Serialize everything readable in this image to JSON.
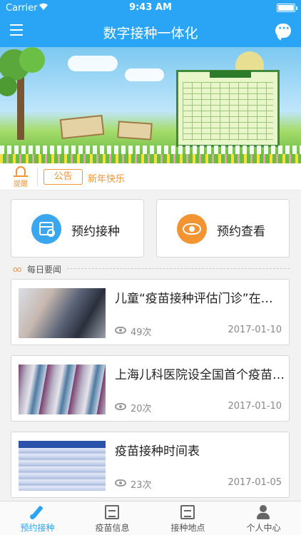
{
  "status_bar": {
    "carrier": "Carrier",
    "time": "9:43 AM"
  },
  "nav_bar": {
    "title": "数字接种一体化",
    "menu_icon": "menu-icon",
    "message_icon": "chat-bubble-icon"
  },
  "notice": {
    "bell_label": "提醒",
    "tag": "公告",
    "text": "新年快乐"
  },
  "actions": [
    {
      "label": "预约接种",
      "icon": "calendar-clock-icon",
      "color": "#3aa6ee"
    },
    {
      "label": "预约查看",
      "icon": "eye-icon",
      "color": "#f39433"
    }
  ],
  "news_section": {
    "title": "每日要闻"
  },
  "news": [
    {
      "title": "儿童“疫苗接种评估门诊”在北京多家医院开诊",
      "views": "49次",
      "date": "2017-01-10"
    },
    {
      "title": "上海儿科医院设全国首个疫苗评估门诊",
      "views": "20次",
      "date": "2017-01-10"
    },
    {
      "title": "疫苗接种时间表",
      "views": "23次",
      "date": "2017-01-05"
    }
  ],
  "tabs": [
    {
      "label": "预约接种",
      "active": true
    },
    {
      "label": "疫苗信息",
      "active": false
    },
    {
      "label": "接种地点",
      "active": false
    },
    {
      "label": "个人中心",
      "active": false
    }
  ],
  "colors": {
    "primary": "#2aa4f4",
    "accent": "#f39433"
  }
}
